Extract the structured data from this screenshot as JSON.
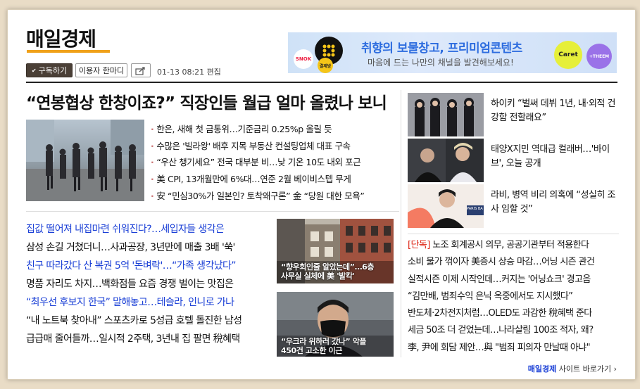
{
  "header": {
    "logo": "매일경제",
    "subscribe_label": "구독하기",
    "comment_label": "이용자 한마디",
    "dateline": "01-13 08:21 편집"
  },
  "banner": {
    "title": "취향의 보물창고, 프리미엄콘텐츠",
    "subtitle": "마음에 드는 나만의 채널을 발견해보세요!",
    "badge_1": "SNOK",
    "badge_2": "결제방",
    "badge_3": "Caret",
    "badge_4": "+THEEM"
  },
  "headline": "“연봉협상 한창이죠?” 직장인들 월급 얼마 올렸나 보니",
  "bullets": [
    "한은, 새해 첫 금통위…기준금리 0.25%p 올릴 듯",
    "수많은 '빌라왕' 배후 지목 부동산 컨설팅업체 대표 구속",
    "“우산 챙기세요” 전국 대부분 비…낮 기온 10도 내외 포근",
    "美 CPI, 13개월만에 6%대…연준 2월 베이비스텝 무게",
    "安 “민심30%가 일본인? 토착왜구론” 金 “당원 대한 모욕”"
  ],
  "news_list": [
    {
      "text": "집값 떨어져 내집마련 쉬워진다?…세입자들 생각은",
      "style": "blue"
    },
    {
      "text": "삼성 손길 거쳤더니…사과공장, 3년만에 매출 3배 '쑥'",
      "style": "black"
    },
    {
      "text": "친구 따라갔다 산 복권 5억 '돈벼락'…“가족 생각났다”",
      "style": "blue"
    },
    {
      "text": "명품 자리도 차지…백화점들 요즘 경쟁 벌이는 맛집은",
      "style": "black"
    },
    {
      "text": "“최우선 후보지 한국” 말해놓고…테슬라, 인니로 가나",
      "style": "blue"
    },
    {
      "text": "“내 노트북 찾아내” 스포츠카로 5성급 호텔 돌진한 남성",
      "style": "black"
    },
    {
      "text": "급급매 줄어들까…일시적 2주택, 3년내 집 팔면 稅혜택",
      "style": "black"
    }
  ],
  "thumbs": [
    {
      "caption_1": "“향우회인줄 알았는데”…6층",
      "caption_2": "사무실 실체에 美 '발칵'"
    },
    {
      "caption_1": "“우크라 위하러 갔나” 악플",
      "caption_2": "450건 고소한 이근"
    }
  ],
  "side_items": [
    {
      "text": "하이키 “벌써 데뷔 1년, 내·외적 건강함 전할래요”"
    },
    {
      "text": "태양X지민 역대급 컬래버…'바이브', 오늘 공개"
    },
    {
      "text": "라비, 병역 비리 의혹에 “성실히 조사 임할 것”"
    }
  ],
  "photo_sign": "PARIS BA",
  "right_list": {
    "first_tag": "[단독]",
    "first_text": " 노조 회계공시 의무, 공공기관부터 적용한다",
    "rows": [
      "소비 물가 꺾이자 美증시 상승 마감…어닝 시즌 관건",
      "실적시즌 이제 시작인데…커지는 '어닝쇼크' 경고음",
      "“김만배, 범죄수익 은닉 옥중에서도 지시했다”",
      "반도체·2차전지처럼…OLED도 과감한 稅혜택 준다",
      "세금 50조 더 걷었는데…나라살림 100조 적자, 왜?",
      "李, 尹에 회담 제안…與 \"범죄 피의자 만날때 아냐\""
    ]
  },
  "footer": {
    "brand": "매일경제",
    "link": " 사이트 바로가기 ›"
  },
  "colors": {
    "accent_blue": "#1a3fd6",
    "logo_bar": "#f0a11a",
    "exclusive_red": "#d21",
    "subscribe_bg": "#4a3f36"
  }
}
